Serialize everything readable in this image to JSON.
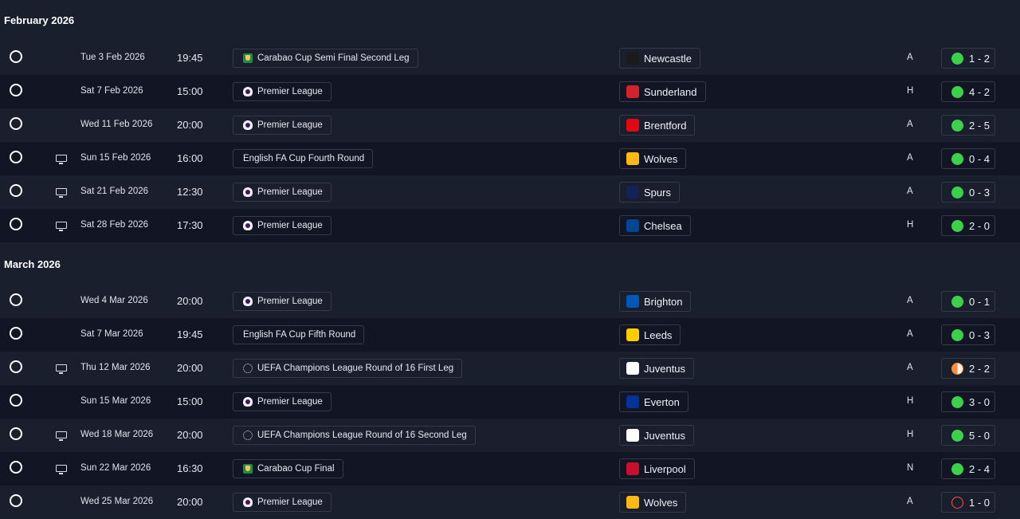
{
  "months": [
    {
      "label": "February 2026",
      "fixtures": [
        {
          "tv": false,
          "date": "Tue 3 Feb 2026",
          "time": "19:45",
          "competition": "Carabao Cup Semi Final Second Leg",
          "comp_icon": "carabao-cup-icon",
          "opponent": "Newcastle",
          "crest_color": "#1b1b1b",
          "venue": "A",
          "score": "1 - 2",
          "outcome": "win"
        },
        {
          "tv": false,
          "date": "Sat 7 Feb 2026",
          "time": "15:00",
          "competition": "Premier League",
          "comp_icon": "premier-league-icon",
          "opponent": "Sunderland",
          "crest_color": "#d2232a",
          "venue": "H",
          "score": "4 - 2",
          "outcome": "win"
        },
        {
          "tv": false,
          "date": "Wed 11 Feb 2026",
          "time": "20:00",
          "competition": "Premier League",
          "comp_icon": "premier-league-icon",
          "opponent": "Brentford",
          "crest_color": "#e30613",
          "venue": "A",
          "score": "2 - 5",
          "outcome": "win"
        },
        {
          "tv": true,
          "date": "Sun 15 Feb 2026",
          "time": "16:00",
          "competition": "English FA Cup Fourth Round",
          "comp_icon": "",
          "opponent": "Wolves",
          "crest_color": "#fdb913",
          "venue": "A",
          "score": "0 - 4",
          "outcome": "win"
        },
        {
          "tv": true,
          "date": "Sat 21 Feb 2026",
          "time": "12:30",
          "competition": "Premier League",
          "comp_icon": "premier-league-icon",
          "opponent": "Spurs",
          "crest_color": "#132257",
          "venue": "A",
          "score": "0 - 3",
          "outcome": "win"
        },
        {
          "tv": true,
          "date": "Sat 28 Feb 2026",
          "time": "17:30",
          "competition": "Premier League",
          "comp_icon": "premier-league-icon",
          "opponent": "Chelsea",
          "crest_color": "#034694",
          "venue": "H",
          "score": "2 - 0",
          "outcome": "win"
        }
      ]
    },
    {
      "label": "March 2026",
      "fixtures": [
        {
          "tv": false,
          "date": "Wed 4 Mar 2026",
          "time": "20:00",
          "competition": "Premier League",
          "comp_icon": "premier-league-icon",
          "opponent": "Brighton",
          "crest_color": "#0057b8",
          "venue": "A",
          "score": "0 - 1",
          "outcome": "win"
        },
        {
          "tv": false,
          "date": "Sat 7 Mar 2026",
          "time": "19:45",
          "competition": "English FA Cup Fifth Round",
          "comp_icon": "",
          "opponent": "Leeds",
          "crest_color": "#ffcd00",
          "venue": "A",
          "score": "0 - 3",
          "outcome": "win"
        },
        {
          "tv": true,
          "date": "Thu 12 Mar 2026",
          "time": "20:00",
          "competition": "UEFA Champions League Round of 16  First Leg",
          "comp_icon": "champions-league-icon",
          "opponent": "Juventus",
          "crest_color": "#ffffff",
          "venue": "A",
          "score": "2 - 2",
          "outcome": "draw"
        },
        {
          "tv": false,
          "date": "Sun 15 Mar 2026",
          "time": "15:00",
          "competition": "Premier League",
          "comp_icon": "premier-league-icon",
          "opponent": "Everton",
          "crest_color": "#003399",
          "venue": "H",
          "score": "3 - 0",
          "outcome": "win"
        },
        {
          "tv": true,
          "date": "Wed 18 Mar 2026",
          "time": "20:00",
          "competition": "UEFA Champions League Round of 16  Second Leg",
          "comp_icon": "champions-league-icon",
          "opponent": "Juventus",
          "crest_color": "#ffffff",
          "venue": "H",
          "score": "5 - 0",
          "outcome": "win"
        },
        {
          "tv": true,
          "date": "Sun 22 Mar 2026",
          "time": "16:30",
          "competition": "Carabao Cup Final",
          "comp_icon": "carabao-cup-icon",
          "opponent": "Liverpool",
          "crest_color": "#c8102e",
          "venue": "N",
          "score": "2 - 4",
          "outcome": "win"
        },
        {
          "tv": false,
          "date": "Wed 25 Mar 2026",
          "time": "20:00",
          "competition": "Premier League",
          "comp_icon": "premier-league-icon",
          "opponent": "Wolves",
          "crest_color": "#fdb913",
          "venue": "A",
          "score": "1 - 0",
          "outcome": "loss"
        }
      ]
    }
  ]
}
